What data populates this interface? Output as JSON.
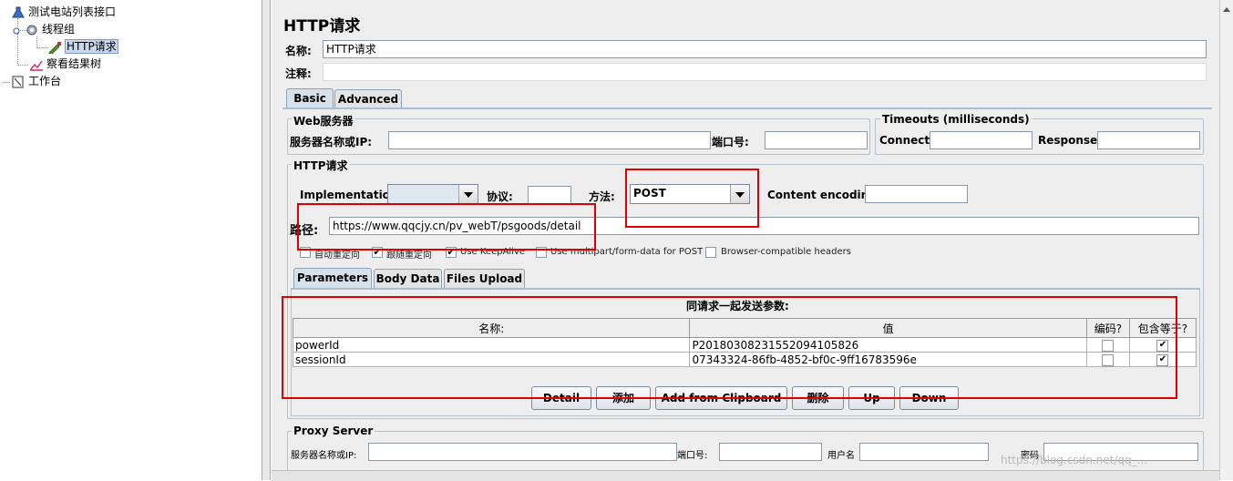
{
  "tree": {
    "nodes": [
      {
        "label": "测试电站列表接口",
        "icon": "flask-icon"
      },
      {
        "label": "线程组",
        "icon": "gear-icon"
      },
      {
        "label": "HTTP请求",
        "icon": "dropper-icon"
      },
      {
        "label": "察看结果树",
        "icon": "chart-icon"
      },
      {
        "label": "工作台",
        "icon": "workbench-icon"
      }
    ]
  },
  "panel": {
    "title": "HTTP请求",
    "name_label": "名称:",
    "name_value": "HTTP请求",
    "comment_label": "注释:",
    "comment_value": ""
  },
  "tabs": [
    {
      "label": "Basic",
      "active": true
    },
    {
      "label": "Advanced",
      "active": false
    }
  ],
  "web_server": {
    "title": "Web服务器",
    "server_label": "服务器名称或IP:",
    "server_value": "",
    "port_label": "端口号:",
    "port_value": ""
  },
  "timeouts": {
    "title": "Timeouts (milliseconds)",
    "connect_label": "Connect:",
    "connect_value": "",
    "response_label": "Response:",
    "response_value": ""
  },
  "http_request": {
    "title": "HTTP请求",
    "implementation_label": "Implementation:",
    "implementation_value": "",
    "protocol_label": "协议:",
    "protocol_value": "",
    "method_label": "方法:",
    "method_value": "POST",
    "encoding_label": "Content encoding:",
    "encoding_value": "",
    "path_label": "路径:",
    "path_value": "https://www.qqcjy.cn/pv_webT/psgoods/detail",
    "options": [
      {
        "label": "自动重定向",
        "checked": false
      },
      {
        "label": "跟随重定向",
        "checked": true
      },
      {
        "label": "Use KeepAlive",
        "checked": true
      },
      {
        "label": "Use multipart/form-data for POST",
        "checked": false
      },
      {
        "label": "Browser-compatible headers",
        "checked": false
      }
    ]
  },
  "subtabs": [
    {
      "label": "Parameters",
      "active": true
    },
    {
      "label": "Body Data",
      "active": false
    },
    {
      "label": "Files Upload",
      "active": false
    }
  ],
  "params": {
    "heading": "同请求一起发送参数:",
    "columns": [
      "名称:",
      "值",
      "编码?",
      "包含等于?"
    ],
    "rows": [
      {
        "name": "powerId",
        "value": "P20180308231552094105826",
        "encode": false,
        "include_equals": true
      },
      {
        "name": "sessionId",
        "value": "07343324-86fb-4852-bf0c-9ff16783596e",
        "encode": false,
        "include_equals": true
      }
    ]
  },
  "buttons": {
    "detail": "Detail",
    "add": "添加",
    "add_clipboard": "Add from Clipboard",
    "delete": "删除",
    "up": "Up",
    "down": "Down"
  },
  "proxy": {
    "title": "Proxy Server",
    "server_label": "服务器名称或IP:",
    "port_label": "端口号:",
    "user_label": "用户名",
    "password_label": "密码"
  },
  "watermark": "https://blog.csdn.net/qq_...",
  "colors": {
    "highlight_red": "#e00000",
    "tab_active": "#d6e1ea",
    "panel_bg": "#eeeeee",
    "selection": "#c8d8ee"
  }
}
